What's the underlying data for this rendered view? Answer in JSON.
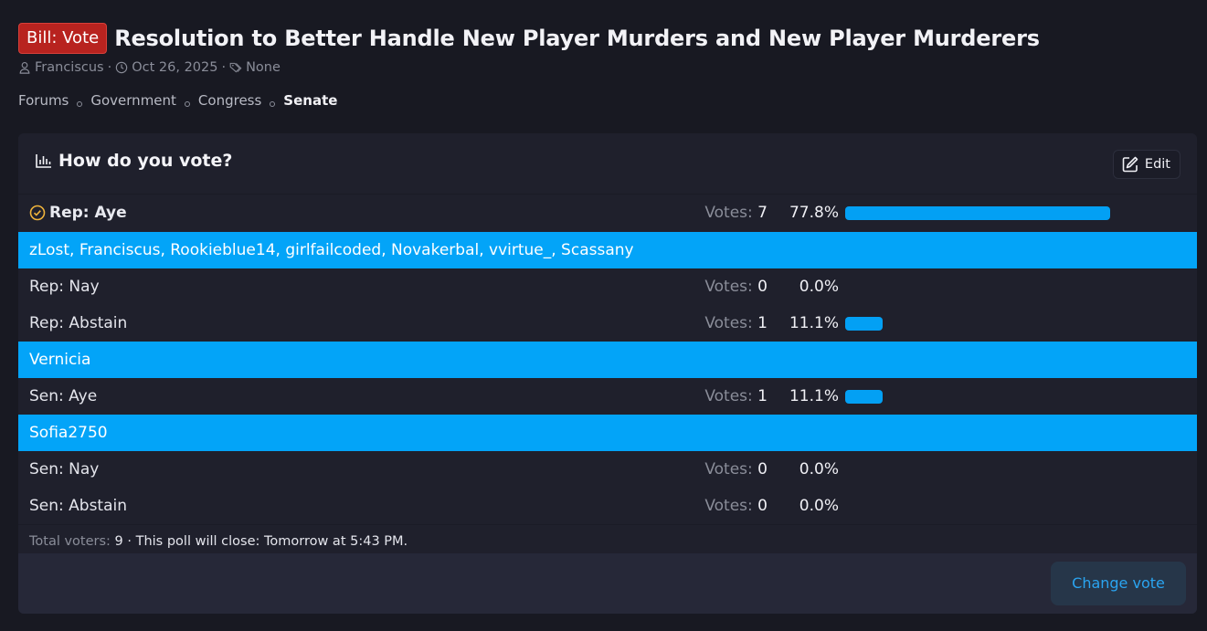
{
  "thread": {
    "prefix": "Bill: Vote",
    "title": "Resolution to Better Handle New Player Murders and New Player Murderers",
    "author": "Franciscus",
    "date": "Oct 26, 2025",
    "tags": "None",
    "sep": "·"
  },
  "breadcrumbs": [
    "Forums",
    "Government",
    "Congress",
    "Senate"
  ],
  "poll": {
    "question": "How do you vote?",
    "edit_label": "Edit",
    "votes_label": "Votes:",
    "options": [
      {
        "label": "Rep: Aye",
        "votes": "7",
        "percent": "77.8%",
        "fraction": 0.778,
        "voted": true,
        "voters": "zLost, Franciscus, Rookieblue14, girlfailcoded, Novakerbal, vvirtue_, Scassany"
      },
      {
        "label": "Rep: Nay",
        "votes": "0",
        "percent": "0.0%",
        "fraction": 0,
        "voted": false,
        "voters": ""
      },
      {
        "label": "Rep: Abstain",
        "votes": "1",
        "percent": "11.1%",
        "fraction": 0.111,
        "voted": false,
        "voters": "Vernicia"
      },
      {
        "label": "Sen: Aye",
        "votes": "1",
        "percent": "11.1%",
        "fraction": 0.111,
        "voted": false,
        "voters": "Sofia2750"
      },
      {
        "label": "Sen: Nay",
        "votes": "0",
        "percent": "0.0%",
        "fraction": 0,
        "voted": false,
        "voters": ""
      },
      {
        "label": "Sen: Abstain",
        "votes": "0",
        "percent": "0.0%",
        "fraction": 0,
        "voted": false,
        "voters": ""
      }
    ],
    "footer": {
      "total_label": "Total voters:",
      "total": "9",
      "close_text": "· This poll will close: Tomorrow at 5:43 PM."
    },
    "change_vote_label": "Change vote"
  },
  "colors": {
    "accent": "#03a4f8",
    "prefix_red": "#b8231f",
    "voted_icon": "#f0b43c"
  }
}
